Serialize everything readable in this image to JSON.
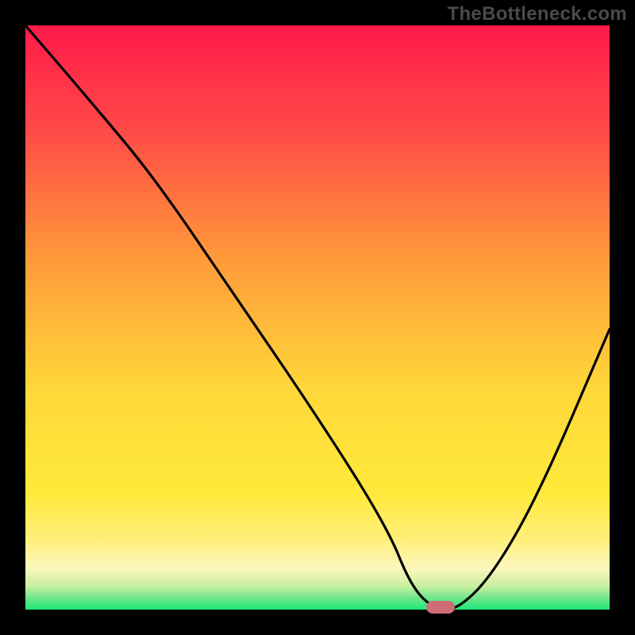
{
  "watermark": "TheBottleneck.com",
  "colors": {
    "bg_black": "#000000",
    "grad_top": "#ff1a4a",
    "grad_mid1": "#ff6a3a",
    "grad_mid2": "#ffd73a",
    "grad_yellow_soft": "#ffef7a",
    "grad_yellow_pale": "#fff7bd",
    "grad_green": "#1fe67a",
    "curve": "#000000",
    "marker": "#ce6d76"
  },
  "chart_data": {
    "type": "line",
    "title": "",
    "xlabel": "",
    "ylabel": "",
    "xlim": [
      0,
      100
    ],
    "ylim": [
      0,
      100
    ],
    "series": [
      {
        "name": "bottleneck-curve",
        "x": [
          0,
          12,
          22,
          35,
          50,
          62,
          66,
          70,
          74,
          80,
          88,
          100
        ],
        "values": [
          100,
          86,
          74,
          55,
          33,
          14,
          4,
          0,
          0,
          6,
          20,
          48
        ]
      }
    ],
    "marker": {
      "x": 71,
      "y": 0
    },
    "annotations": {
      "watermark": "TheBottleneck.com"
    }
  }
}
